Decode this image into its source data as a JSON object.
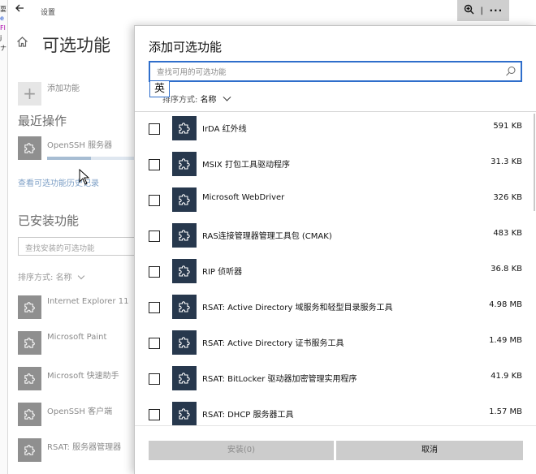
{
  "window": {
    "title": "设置",
    "left_fragments": [
      "耍",
      "e",
      "Fl",
      "j",
      "ナ"
    ]
  },
  "page": {
    "title": "可选功能",
    "add_feature_label": "添加功能",
    "recent_heading": "最近操作",
    "recent_item": {
      "name": "OpenSSH 服务器",
      "progress_fraction": 0.5
    },
    "history_link": "查看可选功能历史记录",
    "installed_heading": "已安装功能",
    "installed_search_placeholder": "查找安装的可选功能",
    "sort_label": "排序方式:",
    "sort_value": "名称",
    "installed_items": [
      {
        "name": "Internet Explorer 11"
      },
      {
        "name": "Microsoft Paint"
      },
      {
        "name": "Microsoft 快速助手"
      },
      {
        "name": "OpenSSH 客户端"
      },
      {
        "name": "RSAT: 服务器管理器"
      }
    ]
  },
  "dialog": {
    "title": "添加可选功能",
    "search_placeholder": "查找可用的可选功能",
    "ime_indicator": "英",
    "sort_label": "排序方式:",
    "sort_value": "名称",
    "features": [
      {
        "name": "IrDA 红外线",
        "size": "591 KB"
      },
      {
        "name": "MSIX 打包工具驱动程序",
        "size": "31.3 KB"
      },
      {
        "name": "Microsoft WebDriver",
        "size": "326 KB"
      },
      {
        "name": "RAS连接管理器管理工具包 (CMAK)",
        "size": "483 KB"
      },
      {
        "name": "RIP 侦听器",
        "size": "36.8 KB"
      },
      {
        "name": "RSAT: Active Directory 域服务和轻型目录服务工具",
        "size": "4.98 MB"
      },
      {
        "name": "RSAT: Active Directory 证书服务工具",
        "size": "1.49 MB"
      },
      {
        "name": "RSAT: BitLocker 驱动器加密管理实用程序",
        "size": "41.9 KB"
      },
      {
        "name": "RSAT: DHCP 服务器工具",
        "size": "1.57 MB"
      }
    ],
    "install_button": "安装(0)",
    "cancel_button": "取消"
  }
}
